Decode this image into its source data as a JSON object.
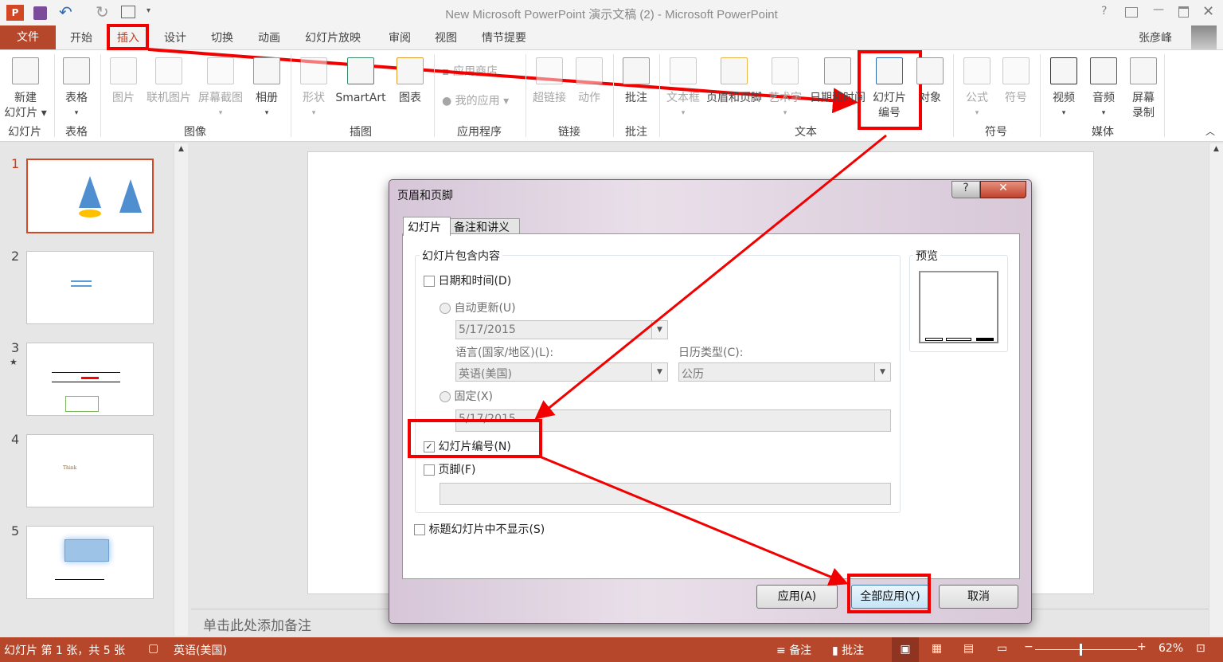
{
  "window": {
    "title": "New Microsoft PowerPoint 演示文稿 (2) - Microsoft PowerPoint",
    "user": "张彦峰",
    "help": "?"
  },
  "tabs": {
    "file": "文件",
    "items": [
      "开始",
      "插入",
      "设计",
      "切换",
      "动画",
      "幻灯片放映",
      "审阅",
      "视图",
      "情节提要"
    ],
    "active": "插入"
  },
  "ribbon": {
    "items": [
      {
        "label": "新建\n幻灯片 ▾",
        "disabled": false
      },
      {
        "label": "表格\n▾",
        "disabled": false
      },
      {
        "label": "图片",
        "disabled": true
      },
      {
        "label": "联机图片",
        "disabled": true
      },
      {
        "label": "屏幕截图\n▾",
        "disabled": true
      },
      {
        "label": "相册\n▾",
        "disabled": false
      },
      {
        "label": "形状\n▾",
        "disabled": true
      },
      {
        "label": "SmartArt",
        "disabled": false
      },
      {
        "label": "图表",
        "disabled": false
      },
      {
        "label": "超链接",
        "disabled": true
      },
      {
        "label": "动作",
        "disabled": true
      },
      {
        "label": "批注",
        "disabled": false
      },
      {
        "label": "文本框\n▾",
        "disabled": true
      },
      {
        "label": "页眉和页脚",
        "disabled": false
      },
      {
        "label": "艺术字\n▾",
        "disabled": true
      },
      {
        "label": "日期和时间",
        "disabled": false
      },
      {
        "label": "幻灯片\n编号",
        "disabled": false
      },
      {
        "label": "对象",
        "disabled": false
      },
      {
        "label": "公式\n▾",
        "disabled": true
      },
      {
        "label": "符号",
        "disabled": true
      },
      {
        "label": "视频\n▾",
        "disabled": false
      },
      {
        "label": "音频\n▾",
        "disabled": false
      },
      {
        "label": "屏幕\n录制",
        "disabled": false
      }
    ],
    "app_store": "应用商店",
    "my_apps": "我的应用 ▾",
    "groups": [
      "幻灯片",
      "表格",
      "图像",
      "插图",
      "应用程序",
      "链接",
      "批注",
      "文本",
      "符号",
      "媒体"
    ]
  },
  "thumbnails": [
    {
      "num": "1"
    },
    {
      "num": "2"
    },
    {
      "num": "3",
      "star": "★"
    },
    {
      "num": "4",
      "text": "Think"
    },
    {
      "num": "5"
    }
  ],
  "notes_placeholder": "单击此处添加备注",
  "status": {
    "slide_info": "幻灯片 第 1 张，共 5 张",
    "language": "英语(美国)",
    "notes": "备注",
    "comments": "批注",
    "zoom": "62%",
    "zoom_level": 62
  },
  "dialog": {
    "title": "页眉和页脚",
    "tabs": [
      "幻灯片",
      "备注和讲义"
    ],
    "group_title": "幻灯片包含内容",
    "date_time": {
      "label": "日期和时间(D)",
      "checked": false
    },
    "auto_update": {
      "label": "自动更新(U)",
      "value": "5/17/2015"
    },
    "language_label": "语言(国家/地区)(L):",
    "language_value": "英语(美国)",
    "calendar_label": "日历类型(C):",
    "calendar_value": "公历",
    "fixed": {
      "label": "固定(X)",
      "value": "5/17/2015"
    },
    "slide_number": {
      "label": "幻灯片编号(N)",
      "checked": true
    },
    "footer": {
      "label": "页脚(F)",
      "checked": false,
      "value": ""
    },
    "hide_title": {
      "label": "标题幻灯片中不显示(S)",
      "checked": false
    },
    "preview": "预览",
    "buttons": {
      "apply": "应用(A)",
      "apply_all": "全部应用(Y)",
      "cancel": "取消"
    }
  },
  "colors": {
    "accent": "#b7472a",
    "annotation": "#f20000"
  }
}
